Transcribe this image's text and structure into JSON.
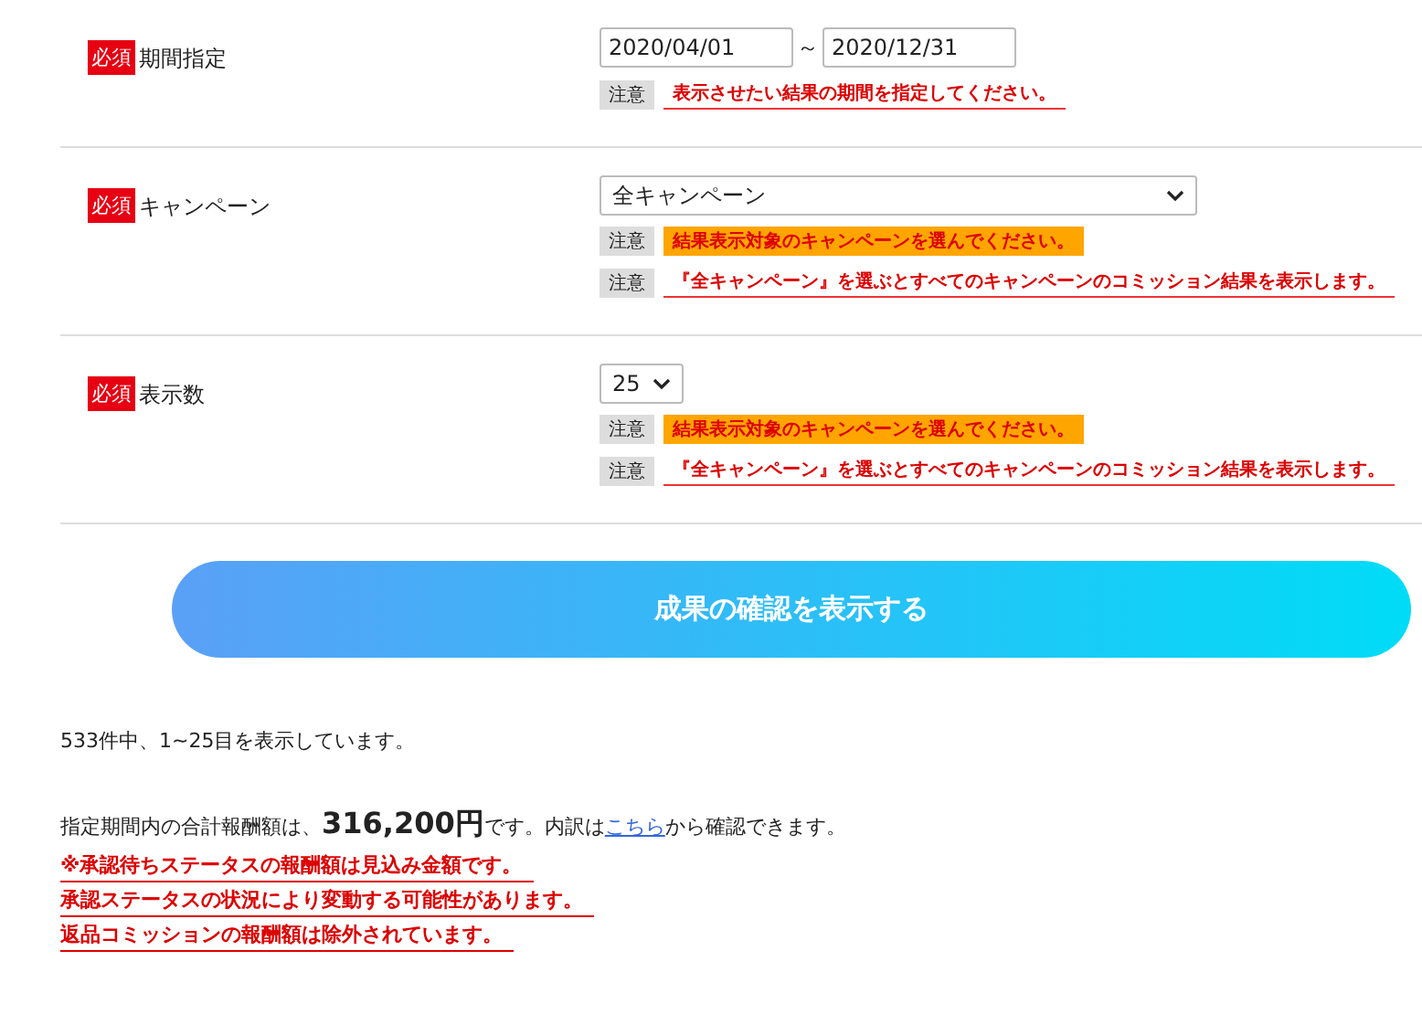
{
  "form_rows": [
    {
      "badge": "必須",
      "label": "期間指定",
      "field": {
        "kind": "date_range",
        "from": "2020/04/01",
        "separator": "～",
        "to": "2020/12/31"
      },
      "notes": [
        {
          "tag": "注意",
          "text": "表示させたい結果の期間を指定してください。",
          "kind": "underline"
        }
      ]
    },
    {
      "badge": "必須",
      "label": "キャンペーン",
      "field": {
        "kind": "select_wide",
        "value": "全キャンペーン"
      },
      "notes": [
        {
          "tag": "注意",
          "text": "結果表示対象のキャンペーンを選んでください。",
          "kind": "highlight"
        },
        {
          "tag": "注意",
          "text": "『全キャンペーン』を選ぶとすべてのキャンペーンのコミッション結果を表示します。",
          "kind": "underline"
        }
      ]
    },
    {
      "badge": "必須",
      "label": "表示数",
      "field": {
        "kind": "select_small",
        "value": "25"
      },
      "notes": [
        {
          "tag": "注意",
          "text": "結果表示対象のキャンペーンを選んでください。",
          "kind": "highlight"
        },
        {
          "tag": "注意",
          "text": "『全キャンペーン』を選ぶとすべてのキャンペーンのコミッション結果を表示します。",
          "kind": "underline"
        }
      ]
    }
  ],
  "submit_button": "成果の確認を表示する",
  "result_count": "533件中、1~25目を表示しています。",
  "total": {
    "prefix": "指定期間内の合計報酬額は、",
    "amount": "316,200円",
    "middle": "です。内訳は",
    "link": "こちら",
    "suffix": "から確認できます。"
  },
  "warnings": [
    "※承認待ちステータスの報酬額は見込み金額です。",
    "承認ステータスの状況により変動する可能性があります。",
    "返品コミッションの報酬額は除外されています。"
  ]
}
